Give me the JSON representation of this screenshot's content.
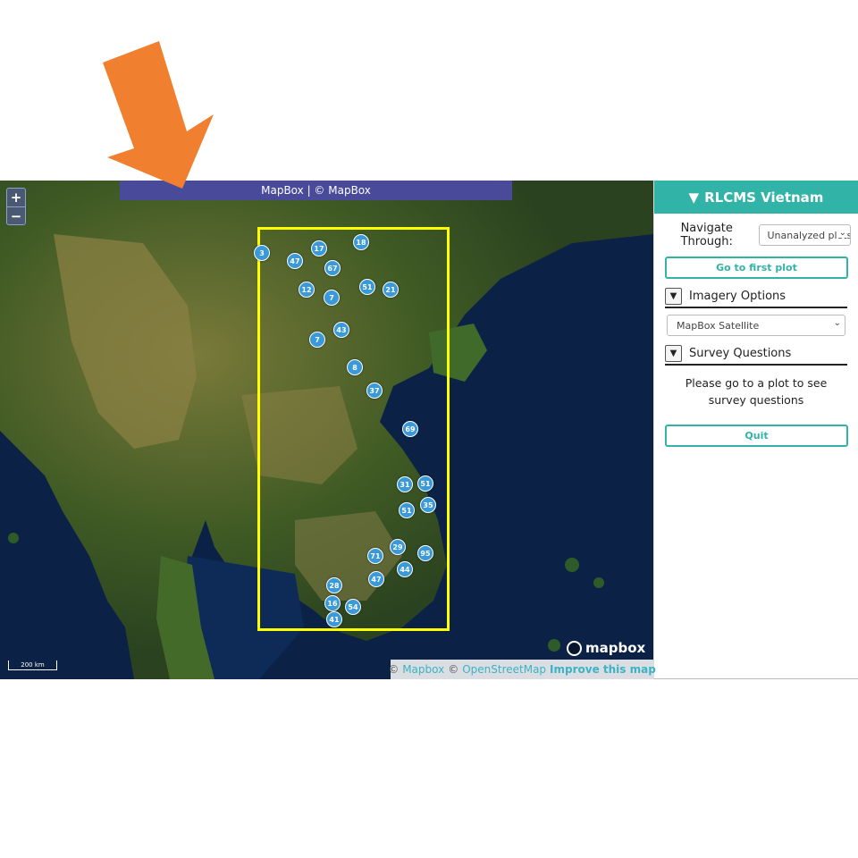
{
  "map": {
    "banner_text": "MapBox | © MapBox",
    "zoom_in": "+",
    "zoom_out": "−",
    "scale_label": "200 km",
    "logo_text": "mapbox",
    "attribution": {
      "copy1": "©",
      "mapbox_link": "Mapbox",
      "copy2": "©",
      "osm_link": "OpenStreetMap",
      "improve_link": "Improve this map"
    },
    "clusters": [
      "3",
      "47",
      "17",
      "18",
      "67",
      "12",
      "7",
      "51",
      "21",
      "7",
      "43",
      "8",
      "37",
      "69",
      "31",
      "51",
      "51",
      "35",
      "29",
      "95",
      "71",
      "44",
      "47",
      "28",
      "16",
      "54",
      "41"
    ],
    "colors": {
      "aoi_box": "#ffff00",
      "cluster": "#3a9ad9",
      "banner": "#4a4a9a",
      "arrow": "#f07f2f"
    }
  },
  "panel": {
    "title": "RLCMS Vietnam",
    "title_icon": "triangle-down-icon",
    "nav_label": "Navigate Through:",
    "nav_select_value": "Unanalyzed plots",
    "first_plot_button": "Go to first plot",
    "imagery_section": "Imagery Options",
    "imagery_select_value": "MapBox Satellite",
    "survey_section": "Survey Questions",
    "survey_message": "Please go to a plot to see survey questions",
    "quit_button": "Quit",
    "colors": {
      "accent": "#31b3a8"
    }
  }
}
